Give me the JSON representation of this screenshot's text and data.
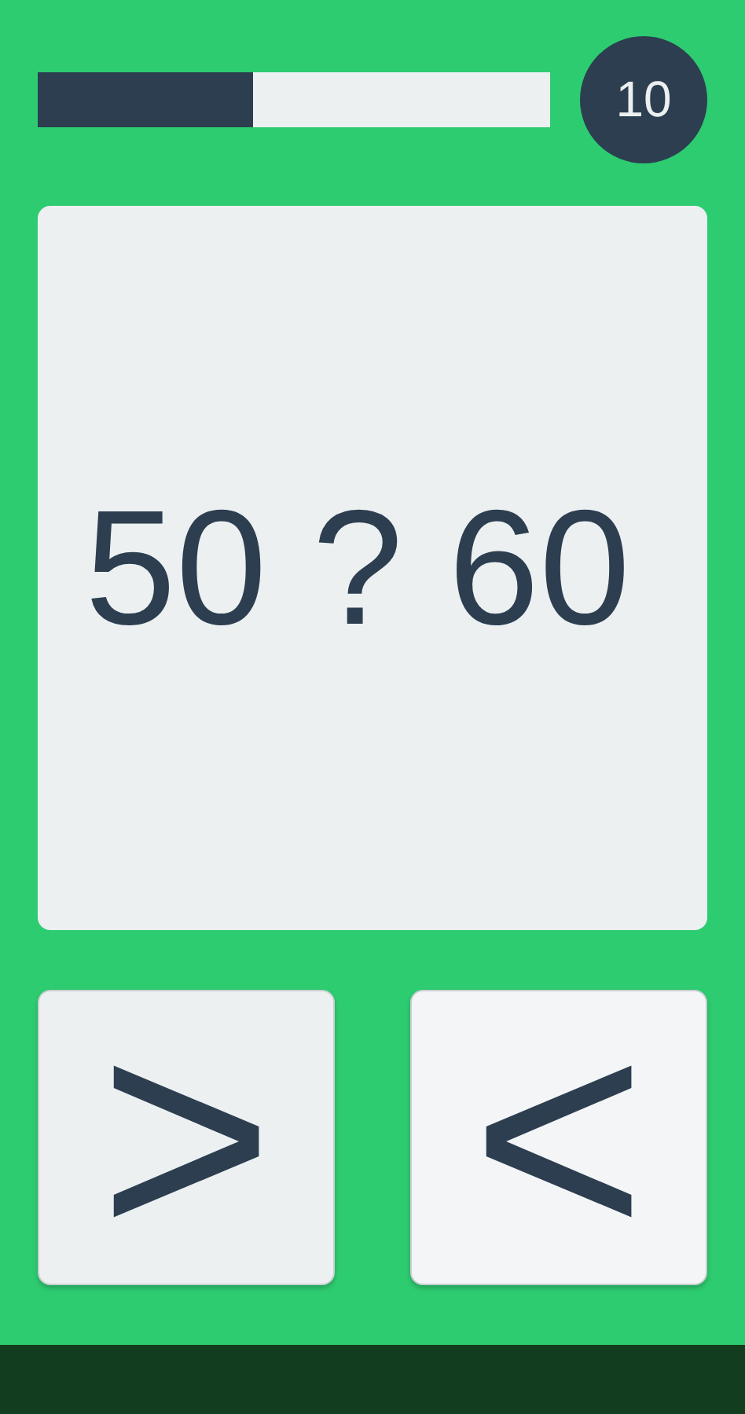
{
  "progress": {
    "level": 0.42
  },
  "score": "10",
  "question": "50 ? 60",
  "answers": [
    {
      "label": ">"
    },
    {
      "label": "<"
    }
  ]
}
